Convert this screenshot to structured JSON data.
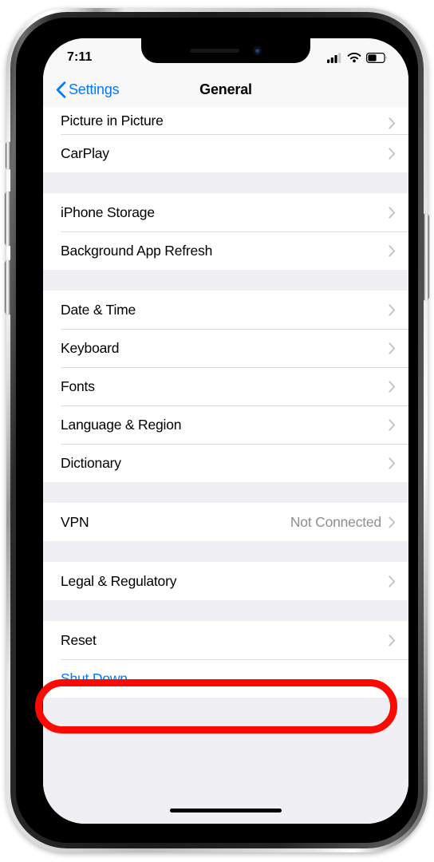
{
  "device": {
    "name": "iphone-x-silver",
    "frame_color": "#c8c8c8",
    "bezel_color": "#000000"
  },
  "status_bar": {
    "time": "7:11",
    "cellular_icon": "cellular-signal-icon",
    "cellular_bars_filled": 3,
    "cellular_bars_total": 4,
    "wifi_icon": "wifi-icon",
    "battery_icon": "battery-icon",
    "battery_level_percent": 50
  },
  "nav_bar": {
    "back_icon": "chevron-left-icon",
    "back_label": "Settings",
    "title": "General"
  },
  "accent_colors": {
    "ios_blue": "#007aff",
    "annotation_red": "#fa0a00",
    "value_gray": "#8e8e93",
    "group_background": "#efeff4",
    "row_background": "#ffffff"
  },
  "groups": [
    {
      "id": "media-group",
      "partial_top": true,
      "rows": [
        {
          "label": "Picture in Picture",
          "value": "",
          "chevron": true,
          "style": "default"
        },
        {
          "label": "CarPlay",
          "value": "",
          "chevron": true,
          "style": "default"
        }
      ]
    },
    {
      "id": "storage-group",
      "partial_top": false,
      "rows": [
        {
          "label": "iPhone Storage",
          "value": "",
          "chevron": true,
          "style": "default"
        },
        {
          "label": "Background App Refresh",
          "value": "",
          "chevron": true,
          "style": "default"
        }
      ]
    },
    {
      "id": "localization-group",
      "partial_top": false,
      "rows": [
        {
          "label": "Date & Time",
          "value": "",
          "chevron": true,
          "style": "default"
        },
        {
          "label": "Keyboard",
          "value": "",
          "chevron": true,
          "style": "default"
        },
        {
          "label": "Fonts",
          "value": "",
          "chevron": true,
          "style": "default"
        },
        {
          "label": "Language & Region",
          "value": "",
          "chevron": true,
          "style": "default"
        },
        {
          "label": "Dictionary",
          "value": "",
          "chevron": true,
          "style": "default"
        }
      ]
    },
    {
      "id": "vpn-group",
      "partial_top": false,
      "rows": [
        {
          "label": "VPN",
          "value": "Not Connected",
          "chevron": true,
          "style": "default"
        }
      ]
    },
    {
      "id": "legal-group",
      "partial_top": false,
      "rows": [
        {
          "label": "Legal & Regulatory",
          "value": "",
          "chevron": true,
          "style": "default"
        }
      ]
    },
    {
      "id": "reset-group",
      "partial_top": false,
      "rows": [
        {
          "label": "Reset",
          "value": "",
          "chevron": true,
          "style": "default"
        },
        {
          "label": "Shut Down",
          "value": "",
          "chevron": false,
          "style": "link"
        }
      ]
    }
  ],
  "annotation": {
    "type": "ellipse-highlight",
    "color": "#fa0a00",
    "target_row_label": "Reset"
  },
  "home_indicator": {
    "name": "home-indicator"
  }
}
